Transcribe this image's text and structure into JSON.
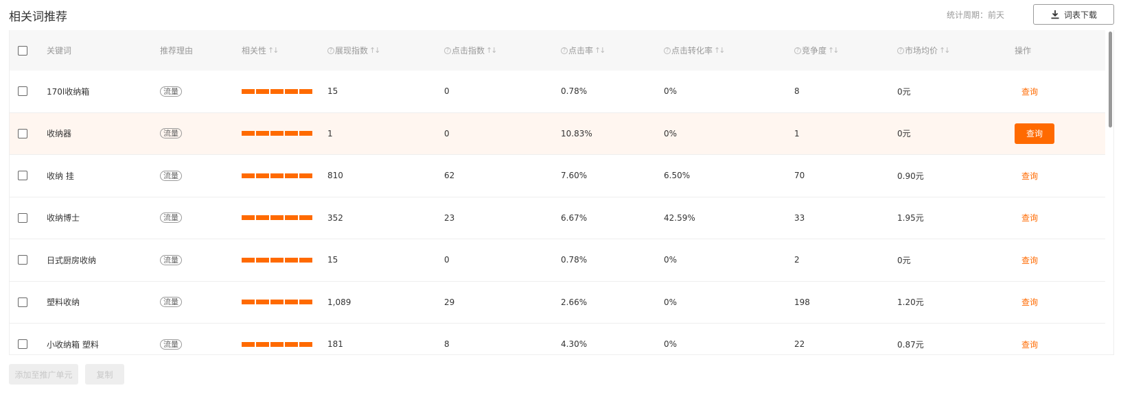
{
  "header": {
    "title": "相关词推荐",
    "period": "统计周期：前天",
    "download_label": "词表下载"
  },
  "table": {
    "columns": {
      "keyword": "关键词",
      "reason": "推荐理由",
      "relevance": "相关性",
      "impressions": "展现指数",
      "clicks": "点击指数",
      "ctr": "点击率",
      "cvr": "点击转化率",
      "competition": "竞争度",
      "price": "市场均价",
      "action": "操作"
    },
    "rows": [
      {
        "keyword": "170l收纳箱",
        "reason": "流量",
        "relevance": 5,
        "impressions": "15",
        "clicks": "0",
        "ctr": "0.78%",
        "cvr": "0%",
        "competition": "8",
        "price": "0元",
        "action": "查询"
      },
      {
        "keyword": "收纳器",
        "reason": "流量",
        "relevance": 5,
        "impressions": "1",
        "clicks": "0",
        "ctr": "10.83%",
        "cvr": "0%",
        "competition": "1",
        "price": "0元",
        "action": "查询"
      },
      {
        "keyword": "收纳 挂",
        "reason": "流量",
        "relevance": 5,
        "impressions": "810",
        "clicks": "62",
        "ctr": "7.60%",
        "cvr": "6.50%",
        "competition": "70",
        "price": "0.90元",
        "action": "查询"
      },
      {
        "keyword": "收纳博士",
        "reason": "流量",
        "relevance": 5,
        "impressions": "352",
        "clicks": "23",
        "ctr": "6.67%",
        "cvr": "42.59%",
        "competition": "33",
        "price": "1.95元",
        "action": "查询"
      },
      {
        "keyword": "日式厨房收纳",
        "reason": "流量",
        "relevance": 5,
        "impressions": "15",
        "clicks": "0",
        "ctr": "0.78%",
        "cvr": "0%",
        "competition": "2",
        "price": "0元",
        "action": "查询"
      },
      {
        "keyword": "塑料收纳",
        "reason": "流量",
        "relevance": 5,
        "impressions": "1,089",
        "clicks": "29",
        "ctr": "2.66%",
        "cvr": "0%",
        "competition": "198",
        "price": "1.20元",
        "action": "查询"
      },
      {
        "keyword": "小收纳箱 塑料",
        "reason": "流量",
        "relevance": 5,
        "impressions": "181",
        "clicks": "8",
        "ctr": "4.30%",
        "cvr": "0%",
        "competition": "22",
        "price": "0.87元",
        "action": "查询"
      }
    ]
  },
  "footer": {
    "add_label": "添加至推广单元",
    "copy_label": "复制"
  },
  "colors": {
    "accent": "#ff6a00",
    "highlight_row": "#fff6f0"
  },
  "icons": {
    "download": "download-icon",
    "help": "help-icon",
    "sort": "sort-icon"
  }
}
